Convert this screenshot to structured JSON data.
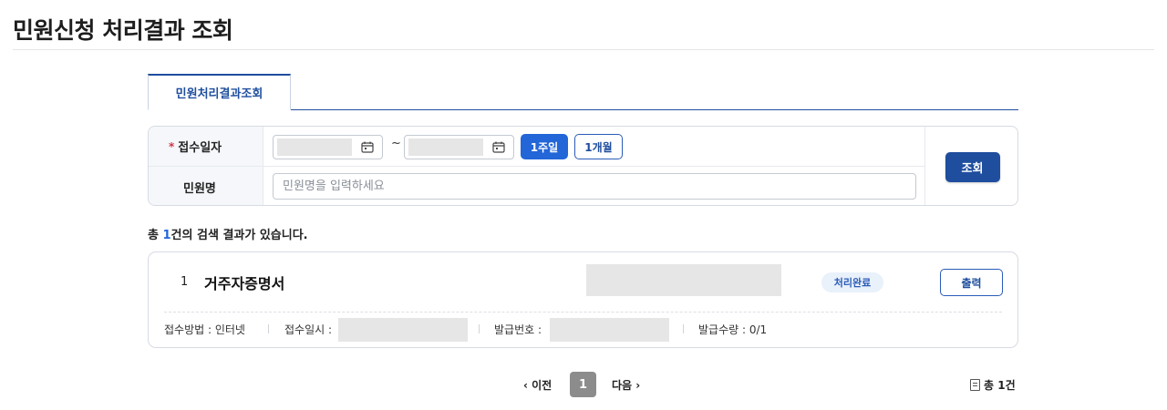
{
  "page": {
    "title": "민원신청 처리결과 조회"
  },
  "tabs": [
    {
      "label": "민원처리결과조회",
      "active": true
    }
  ],
  "search": {
    "received_date_label": "접수일자",
    "required_mark": "*",
    "date_from": "",
    "date_to": "",
    "range_separator": "~",
    "period_buttons": [
      {
        "label": "1주일",
        "active": true
      },
      {
        "label": "1개월",
        "active": false
      }
    ],
    "petition_name_label": "민원명",
    "petition_name_value": "",
    "petition_name_placeholder": "민원명을 입력하세요",
    "search_button": "조회"
  },
  "results": {
    "summary_prefix": "총 ",
    "count": "1",
    "summary_suffix": "건의 검색 결과가 있습니다.",
    "items": [
      {
        "number": "1",
        "title": "거주자증명서",
        "status": "처리완료",
        "print_button": "출력",
        "meta": {
          "method_label": "접수방법 : 인터넷",
          "received_label": "접수일시 :",
          "issue_no_label": "발급번호 :",
          "issue_qty_label": "발급수량 : 0/1"
        }
      }
    ]
  },
  "pagination": {
    "prev": "‹ 이전",
    "current": "1",
    "next": "다음 ›",
    "total": "총 1건"
  },
  "colors": {
    "primary": "#1f4e9e",
    "accent": "#2266d8",
    "badge_bg": "#e9f1fb",
    "required": "#d6334a"
  }
}
